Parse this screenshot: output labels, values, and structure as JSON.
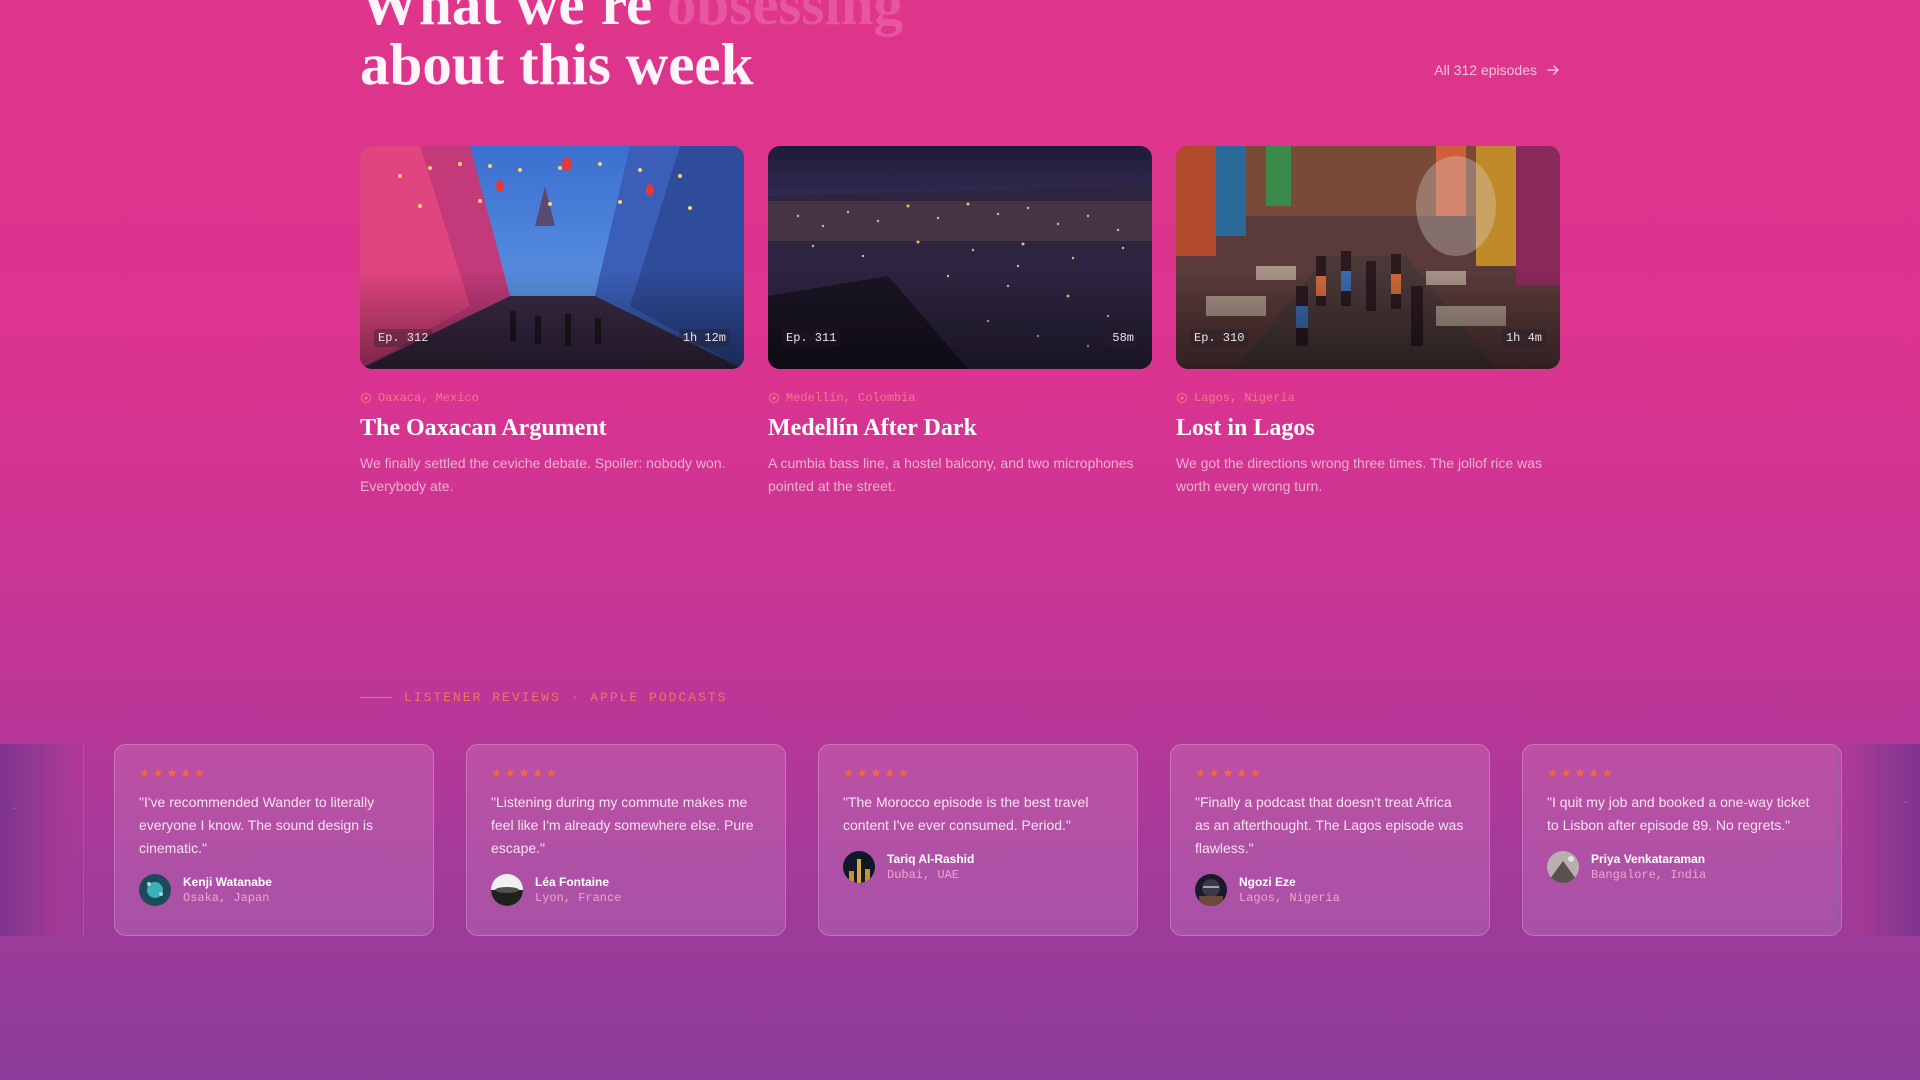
{
  "header": {
    "title_line1": "What we're",
    "title_line1_accent": "obsessing",
    "title_line2": "about this week",
    "all_episodes_label": "All 312 episodes"
  },
  "episodes": [
    {
      "number": "Ep. 312",
      "duration": "1h 12m",
      "location": "Oaxaca, Mexico",
      "title": "The Oaxacan Argument",
      "description": "We finally settled the ceviche debate. Spoiler: nobody won. Everybody ate."
    },
    {
      "number": "Ep. 311",
      "duration": "58m",
      "location": "Medellín, Colombia",
      "title": "Medellín After Dark",
      "description": "A cumbia bass line, a hostel balcony, and two microphones pointed at the street."
    },
    {
      "number": "Ep. 310",
      "duration": "1h 4m",
      "location": "Lagos, Nigeria",
      "title": "Lost in Lagos",
      "description": "We got the directions wrong three times. The jollof rice was worth every wrong turn."
    }
  ],
  "reviews": {
    "label": "LISTENER REVIEWS · APPLE PODCASTS",
    "star_glyph": "★",
    "items": [
      {
        "quote": "\"I've recommended Wander to literally everyone I know. The sound design is cinematic.\"",
        "name": "Kenji Watanabe",
        "location": "Osaka, Japan"
      },
      {
        "quote": "\"Listening during my commute makes me feel like I'm already somewhere else. Pure escape.\"",
        "name": "Léa Fontaine",
        "location": "Lyon, France"
      },
      {
        "quote": "\"The Morocco episode is the best travel content I've ever consumed. Period.\"",
        "name": "Tariq Al-Rashid",
        "location": "Dubai, UAE"
      },
      {
        "quote": "\"Finally a podcast that doesn't treat Africa as an afterthought. The Lagos episode was flawless.\"",
        "name": "Ngozi Eze",
        "location": "Lagos, Nigeria"
      },
      {
        "quote": "\"I quit my job and booked a one-way ticket to Lisbon after episode 89. No regrets.\"",
        "name": "Priya Venkataraman",
        "location": "Bangalore, India"
      }
    ]
  },
  "colors": {
    "accent_orange": "#f36a3e",
    "location_coral": "#f07a82",
    "bg_top": "#df358b",
    "bg_bottom": "#8c3c9a"
  }
}
